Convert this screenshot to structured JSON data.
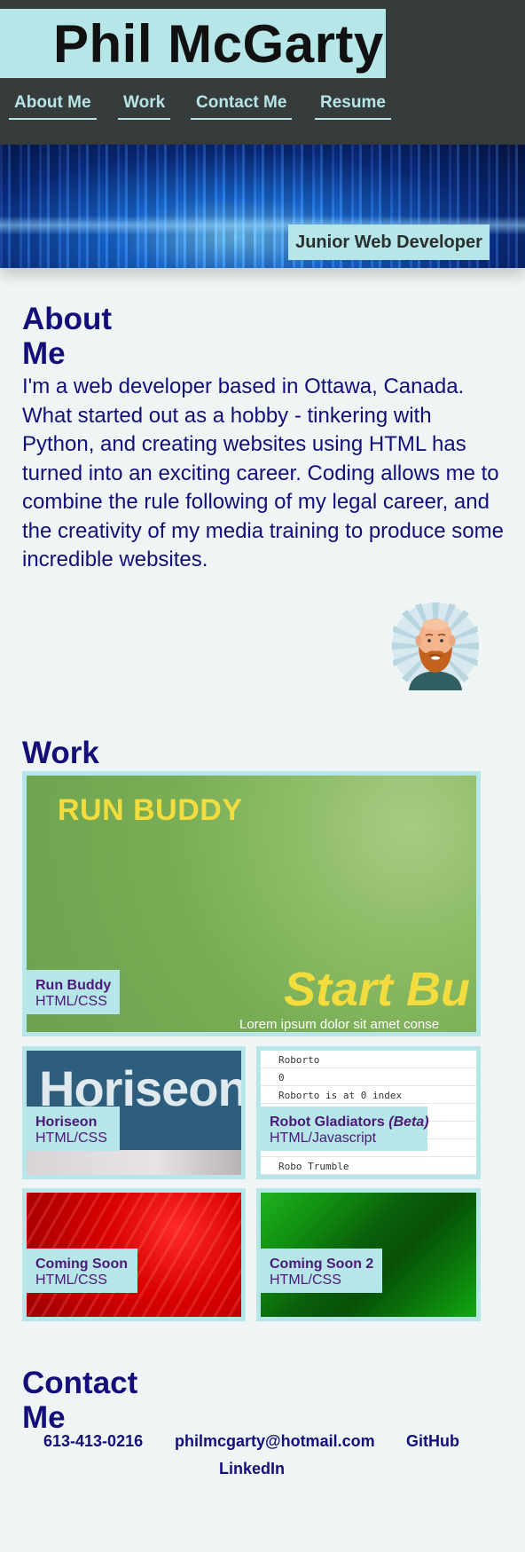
{
  "header": {
    "title": "Phil McGarty",
    "nav": [
      "About Me",
      "Work",
      "Contact Me",
      "Resume"
    ]
  },
  "hero": {
    "badge": "Junior Web Developer"
  },
  "about": {
    "heading": "About Me",
    "text": "I'm a web developer based in Ottawa, Canada. What started out as a hobby - tinkering with Python, and creating websites using HTML has turned into an exciting career. Coding allows me to combine the rule following of my legal career, and the creativity of my media training to produce some incredible websites."
  },
  "work": {
    "heading": "Work",
    "projects": [
      {
        "name": "Run Buddy",
        "tech": "HTML/CSS",
        "preview_title": "RUN BUDDY",
        "preview_cta": "Start Bu",
        "preview_lorem": "Lorem ipsum dolor sit amet conse"
      },
      {
        "name": "Horiseon",
        "tech": "HTML/CSS",
        "preview_word": "Horiseon"
      },
      {
        "name": "Robot Gladiators",
        "name_suffix": "(Beta)",
        "tech": "HTML/Javascript",
        "preview_lines": [
          "Roborto",
          "0",
          "Roborto is at 0 index",
          "",
          "",
          "",
          "Robo Trumble"
        ]
      },
      {
        "name": "Coming Soon",
        "tech": "HTML/CSS"
      },
      {
        "name": "Coming Soon 2",
        "tech": "HTML/CSS"
      }
    ]
  },
  "contact": {
    "heading": "Contact Me",
    "links": [
      "613-413-0216",
      "philmcgarty@hotmail.com",
      "GitHub",
      "LinkedIn"
    ]
  },
  "colors": {
    "accent": "#b6e6e8",
    "header_bg": "#363c3b",
    "text": "#130e7a",
    "page_bg": "#eff5f4"
  }
}
